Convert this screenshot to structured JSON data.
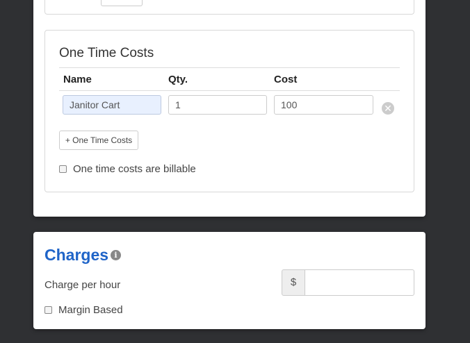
{
  "one_time_costs": {
    "title": "One Time Costs",
    "columns": {
      "name": "Name",
      "qty": "Qty.",
      "cost": "Cost"
    },
    "rows": [
      {
        "name": "Janitor Cart",
        "qty": "1",
        "cost": "100"
      }
    ],
    "add_button_label": "+ One Time Costs",
    "billable_label": "One time costs are billable",
    "billable_checked": false,
    "remove_icon": "x"
  },
  "charges": {
    "title": "Charges",
    "info_icon": "i",
    "charge_per_hour_label": "Charge per hour",
    "currency_symbol": "$",
    "charge_per_hour_value": "",
    "margin_based_label": "Margin Based",
    "margin_based_checked": false
  },
  "colors": {
    "background": "#2f3033",
    "accent": "#1f64c8",
    "autofill": "#e8f0fe"
  }
}
